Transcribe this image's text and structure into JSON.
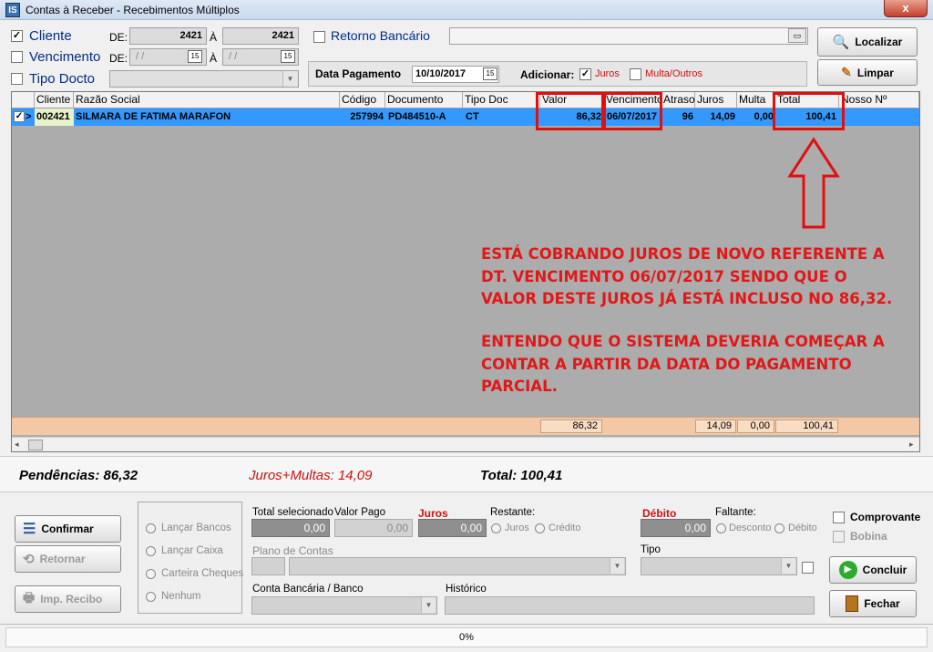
{
  "window": {
    "title": "Contas à Receber - Recebimentos Múltiplos",
    "app_icon": "IS",
    "close_label": "x"
  },
  "filters": {
    "cliente": {
      "label": "Cliente",
      "checked": true,
      "check_mark": "✓",
      "de_label": "DE:",
      "from": "2421",
      "a_label": "À",
      "to": "2421"
    },
    "vencimento": {
      "label": "Vencimento",
      "checked": false,
      "de_label": "DE:",
      "from": "/ /",
      "a_label": "À",
      "to": "/ /",
      "cal_icon": "15"
    },
    "tipo_docto": {
      "label": "Tipo Docto",
      "checked": false,
      "value": ""
    },
    "retorno": {
      "label": "Retorno Bancário",
      "checked": false,
      "value": ""
    }
  },
  "payment": {
    "date_label": "Data Pagamento",
    "date": "10/10/2017",
    "cal_icon": "15",
    "adicionar_label": "Adicionar:",
    "juros_label": "Juros",
    "juros_checked": true,
    "multa_label": "Multa/Outros",
    "multa_checked": false
  },
  "actions": {
    "localizar": "Localizar",
    "limpar": "Limpar"
  },
  "grid": {
    "columns": [
      "Cliente",
      "Razão Social",
      "Código",
      "Documento",
      "Tipo Doc",
      "Valor",
      "Vencimento",
      "Atraso",
      "Juros",
      "Multa",
      "Total",
      "Nosso Nº"
    ],
    "rows": [
      {
        "check": "✓",
        "marker": ">",
        "cliente": "002421",
        "razao": "SILMARA DE FATIMA MARAFON",
        "codigo": "257994",
        "documento": "PD484510-A",
        "tipo": "CT",
        "valor": "86,32",
        "vencimento": "06/07/2017",
        "atraso": "96",
        "juros": "14,09",
        "multa": "0,00",
        "total": "100,41",
        "nosso": ""
      }
    ],
    "totals": {
      "valor": "86,32",
      "juros": "14,09",
      "multa": "0,00",
      "total": "100,41"
    }
  },
  "annotation": {
    "p1": [
      "ESTÁ COBRANDO JUROS DE NOVO REFERENTE A",
      "DT. VENCIMENTO 06/07/2017 SENDO QUE O",
      "VALOR DESTE JUROS JÁ ESTÁ INCLUSO NO 86,32."
    ],
    "p2": [
      "ENTENDO QUE O SISTEMA DEVERIA COMEÇAR A",
      "CONTAR A PARTIR DA DATA DO PAGAMENTO",
      "PARCIAL."
    ],
    "color": "#e01818"
  },
  "summary": {
    "pendencias": "Pendências: 86,32",
    "juros_multas": "Juros+Multas: 14,09",
    "total": "Total: 100,41"
  },
  "bottom": {
    "buttons": {
      "confirmar": "Confirmar",
      "retornar": "Retornar",
      "imp_recibo": "Imp. Recibo",
      "concluir": "Concluir",
      "fechar": "Fechar"
    },
    "radios": [
      "Lançar Bancos",
      "Lançar Caixa",
      "Carteira Cheques",
      "Nenhum"
    ],
    "total_sel_label": "Total selecionado",
    "total_sel": "0,00",
    "valor_pago_label": "Valor Pago",
    "valor_pago": "0,00",
    "juros_label": "Juros",
    "juros": "0,00",
    "restante_label": "Restante:",
    "restante_juros": "Juros",
    "restante_credito": "Crédito",
    "debito_label": "Débito",
    "debito": "0,00",
    "faltante_label": "Faltante:",
    "faltante_desconto": "Desconto",
    "faltante_debito": "Débito",
    "plano_label": "Plano de Contas",
    "tipo_label": "Tipo",
    "conta_label": "Conta Bancária / Banco",
    "historico_label": "Histórico",
    "comprovante_label": "Comprovante",
    "bobina_label": "Bobina"
  },
  "status": {
    "progress": "0%"
  }
}
